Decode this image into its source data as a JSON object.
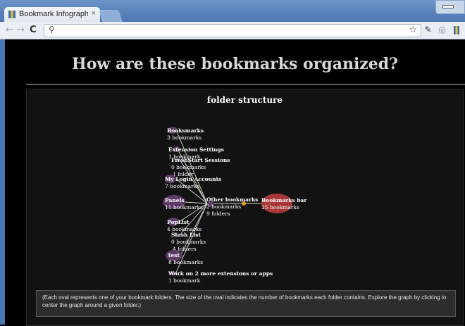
{
  "browser": {
    "tab_title": "Bookmark Infographic for C",
    "tab_close": "×",
    "back": "←",
    "forward": "→",
    "reload": "C",
    "search_glyph": "⚲",
    "star": "☆"
  },
  "page": {
    "heading": "How are these bookmarks organized?",
    "panel_title": "folder structure",
    "note": "(Each oval represents one of your bookmark folders. The size of the oval indicates the number of bookmarks each folder contains. Explore the graph by clicking to center the graph around a given folder.)"
  },
  "graph": {
    "center": {
      "name": "Other bookmarks",
      "line1": "2 bookmarks",
      "line2": "9 folders"
    },
    "root": {
      "name": "Bookmarks bar",
      "line1": "25 bookmarks"
    },
    "folders": [
      {
        "name": "Booksmarks",
        "line1": "3 bookmarks",
        "line2": ""
      },
      {
        "name": "Extension Settings",
        "line1": "1 bookmark",
        "line2": ""
      },
      {
        "name": "FreshStart Sessions",
        "line1": "0 bookmarks",
        "line2": "1 folder"
      },
      {
        "name": "My Login Accounts",
        "line1": "7 bookmarks",
        "line2": ""
      },
      {
        "name": "Panels",
        "line1": "11 bookmarks",
        "line2": ""
      },
      {
        "name": "PopList",
        "line1": "4 bookmarks",
        "line2": ""
      },
      {
        "name": "Stash List",
        "line1": "0 bookmarks",
        "line2": "4 folders"
      },
      {
        "name": "test",
        "line1": "8 bookmarks",
        "line2": ""
      },
      {
        "name": "Work on 2 more extensions or apps",
        "line1": "1 bookmark",
        "line2": ""
      }
    ]
  },
  "colors": {
    "oval": "#5f3b67",
    "root_oval": "#a83838",
    "edge": "#d8d8c8",
    "junction": "#e0a020"
  }
}
